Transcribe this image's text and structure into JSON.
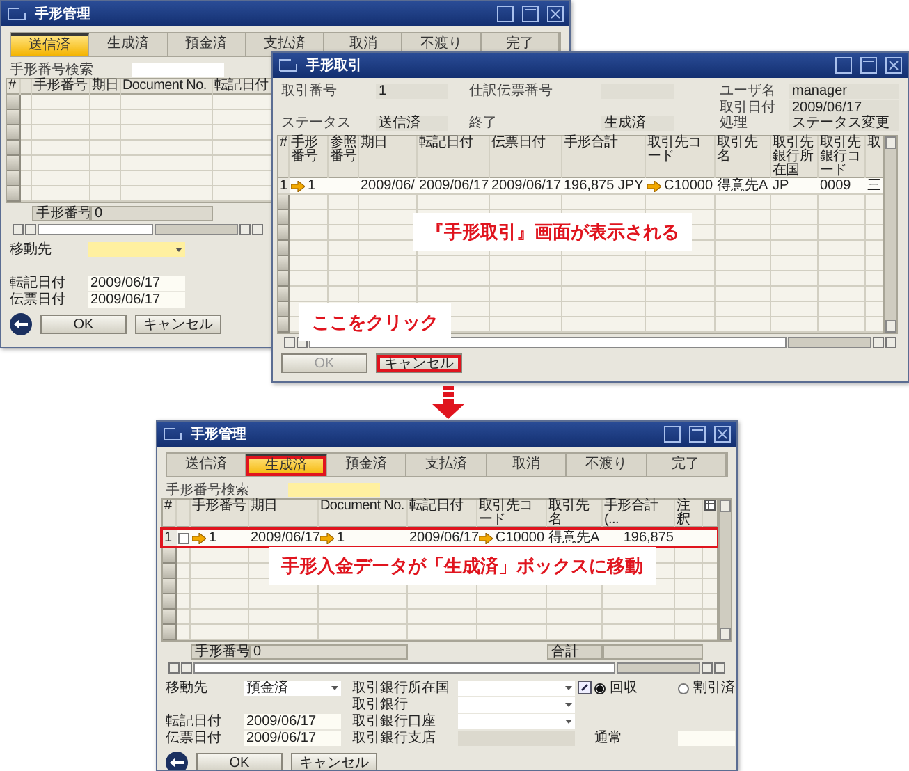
{
  "before_window": {
    "title": "手形管理",
    "tabs": [
      {
        "label": "送信済",
        "selected": true,
        "highlighted": false
      },
      {
        "label": "生成済",
        "selected": false,
        "highlighted": false
      },
      {
        "label": "預金済",
        "selected": false,
        "highlighted": false
      },
      {
        "label": "支払済",
        "selected": false,
        "highlighted": false
      },
      {
        "label": "取消",
        "selected": false,
        "highlighted": false
      },
      {
        "label": "不渡り",
        "selected": false,
        "highlighted": false
      },
      {
        "label": "完了",
        "selected": false,
        "highlighted": false
      }
    ],
    "search": {
      "label": "手形番号検索",
      "focused": false
    },
    "table": {
      "columns": [
        "#",
        "手形番号",
        "期日",
        "Document No.",
        "転記日付"
      ]
    },
    "footer": [
      {
        "label": "手形番号",
        "value": "0"
      }
    ],
    "move_to": {
      "label": "移動先",
      "focused": true
    },
    "dates": [
      {
        "label": "転記日付",
        "value": "2009/06/17"
      },
      {
        "label": "伝票日付",
        "value": "2009/06/17"
      }
    ],
    "buttons": [
      {
        "label": "OK",
        "disabled": false,
        "highlighted": false
      },
      {
        "label": "キャンセル",
        "disabled": false,
        "highlighted": false
      }
    ]
  },
  "transaction_window": {
    "title": "手形取引",
    "field_columns": [
      [
        {
          "label": "取引番号",
          "value": "1"
        },
        {
          "label": "ステータス",
          "value": "送信済"
        }
      ],
      [
        {
          "label": "仕訳伝票番号"
        },
        {
          "label": "終了",
          "value": "生成済"
        }
      ],
      [
        {
          "label": "ユーザ名",
          "value": "manager"
        },
        {
          "label": "取引日付",
          "value": "2009/06/17"
        },
        {
          "label": "処理",
          "value": "ステータス変更"
        }
      ]
    ],
    "table": {
      "columns": [
        "#",
        "手形番号",
        "参照番号",
        "期日",
        "転記日付",
        "伝票日付",
        "手形合計",
        "取引先コード",
        "取引先名",
        "取引先銀行所在国",
        "取引先銀行コード",
        "取"
      ],
      "rows": [
        {
          "highlighted": false,
          "cells": [
            "1",
            {
              "link": "1"
            },
            null,
            "2009/06/",
            "2009/06/17",
            "2009/06/17",
            "196,875 JPY",
            {
              "link": "C10000"
            },
            "得意先A",
            "JP",
            "0009",
            "三"
          ]
        }
      ]
    },
    "buttons": [
      {
        "label": "OK",
        "disabled": true,
        "highlighted": false
      },
      {
        "label": "キャンセル",
        "disabled": false,
        "highlighted": true
      }
    ]
  },
  "after_window": {
    "title": "手形管理",
    "tabs": [
      {
        "label": "送信済",
        "selected": false,
        "highlighted": false
      },
      {
        "label": "生成済",
        "selected": true,
        "highlighted": true
      },
      {
        "label": "預金済",
        "selected": false,
        "highlighted": false
      },
      {
        "label": "支払済",
        "selected": false,
        "highlighted": false
      },
      {
        "label": "取消",
        "selected": false,
        "highlighted": false
      },
      {
        "label": "不渡り",
        "selected": false,
        "highlighted": false
      },
      {
        "label": "完了",
        "selected": false,
        "highlighted": false
      }
    ],
    "search": {
      "label": "手形番号検索",
      "focused": true
    },
    "table": {
      "columns": [
        "#",
        "手形番号",
        "期日",
        "Document No.",
        "転記日付",
        "取引先コード",
        "取引先名",
        "手形合計 (...",
        "注釈"
      ],
      "settings_icon": true,
      "rows": [
        {
          "highlighted": true,
          "checked": false,
          "cells": [
            "1",
            {
              "link": "1"
            },
            "2009/06/17",
            {
              "link": "1"
            },
            "2009/06/17",
            {
              "link": "C10000"
            },
            "得意先A",
            "196,875",
            null
          ]
        }
      ]
    },
    "footer": [
      {
        "label": "手形番号",
        "value": "0"
      },
      {
        "label": "合計"
      }
    ],
    "move_to": {
      "label": "移動先",
      "value": "預金済",
      "focused": false
    },
    "bank_fields": [
      {
        "label": "取引銀行所在国",
        "kind": "dropdown"
      },
      {
        "label": "取引銀行",
        "kind": "dropdown"
      },
      {
        "label": "取引銀行口座",
        "kind": "dropdown"
      },
      {
        "label": "取引銀行支店",
        "kind": "readonly"
      }
    ],
    "payment_options": [
      {
        "label": "回収",
        "selected": true
      },
      {
        "label": "割引済",
        "selected": false
      }
    ],
    "note_field": {
      "label": "通常"
    },
    "dates": [
      {
        "label": "転記日付",
        "value": "2009/06/17"
      },
      {
        "label": "伝票日付",
        "value": "2009/06/17"
      }
    ],
    "buttons": [
      {
        "label": "OK",
        "disabled": false,
        "highlighted": false
      },
      {
        "label": "キャンセル",
        "disabled": false,
        "highlighted": false
      }
    ]
  },
  "annotations": [
    {
      "text": "『手形取引』画面が表示される"
    },
    {
      "text": "ここをクリック"
    },
    {
      "text": "手形入金データが「生成済」ボックスに移動"
    }
  ]
}
